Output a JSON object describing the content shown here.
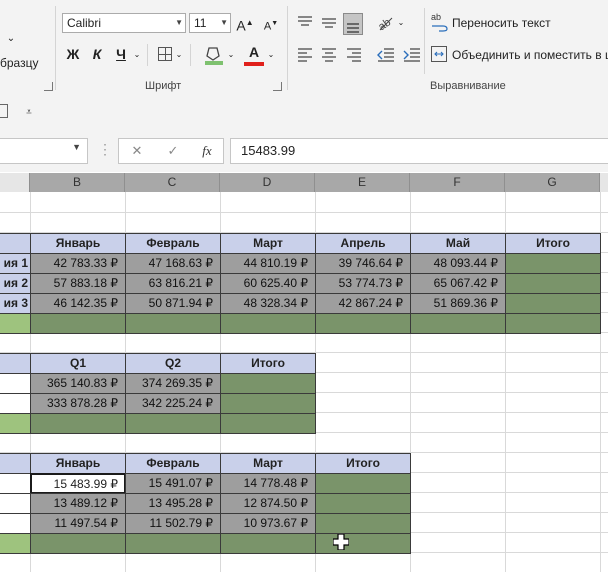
{
  "ribbon": {
    "format_painter_label": "бразцу",
    "font_name": "Calibri",
    "font_size": "11",
    "bold": "Ж",
    "italic": "К",
    "underline": "Ч",
    "grow_font": "A",
    "shrink_font": "A",
    "font_color_letter": "A",
    "font_group_label": "Шрифт",
    "wrap_text_label": "Переносить текст",
    "merge_center_label": "Объединить и поместить в ц",
    "alignment_group_label": "Выравнивание",
    "wrap_icon_text": "ab"
  },
  "formula_bar": {
    "cancel": "✕",
    "enter": "✓",
    "fx": "fx",
    "value": "15483.99"
  },
  "columns": [
    "B",
    "C",
    "D",
    "E",
    "F",
    "G"
  ],
  "table1": {
    "headers": [
      "Январь",
      "Февраль",
      "Март",
      "Апрель",
      "Май",
      "Итого"
    ],
    "row_labels": [
      "ия 1",
      "ия 2",
      "ия 3"
    ],
    "rows": [
      [
        "42 783.33 ₽",
        "47 168.63 ₽",
        "44 810.19 ₽",
        "39 746.64 ₽",
        "48 093.44 ₽"
      ],
      [
        "57 883.18 ₽",
        "63 816.21 ₽",
        "60 625.40 ₽",
        "53 774.73 ₽",
        "65 067.42 ₽"
      ],
      [
        "46 142.35 ₽",
        "50 871.94 ₽",
        "48 328.34 ₽",
        "42 867.24 ₽",
        "51 869.36 ₽"
      ]
    ]
  },
  "table2": {
    "headers": [
      "Q1",
      "Q2",
      "Итого"
    ],
    "rows": [
      [
        "365 140.83 ₽",
        "374 269.35 ₽"
      ],
      [
        "333 878.28 ₽",
        "342 225.24 ₽"
      ]
    ]
  },
  "table3": {
    "headers": [
      "Январь",
      "Февраль",
      "Март",
      "Итого"
    ],
    "rows": [
      [
        "15 483.99 ₽",
        "15 491.07 ₽",
        "14 778.48 ₽"
      ],
      [
        "13 489.12 ₽",
        "13 495.28 ₽",
        "12 874.50 ₽"
      ],
      [
        "11 497.54 ₽",
        "11 502.79 ₽",
        "10 973.67 ₽"
      ]
    ]
  },
  "colors": {
    "header_fill": "#c9d0ea",
    "value_fill": "#9e9e9e",
    "total_fill": "#7a946a",
    "light_green": "#9ec37e"
  }
}
